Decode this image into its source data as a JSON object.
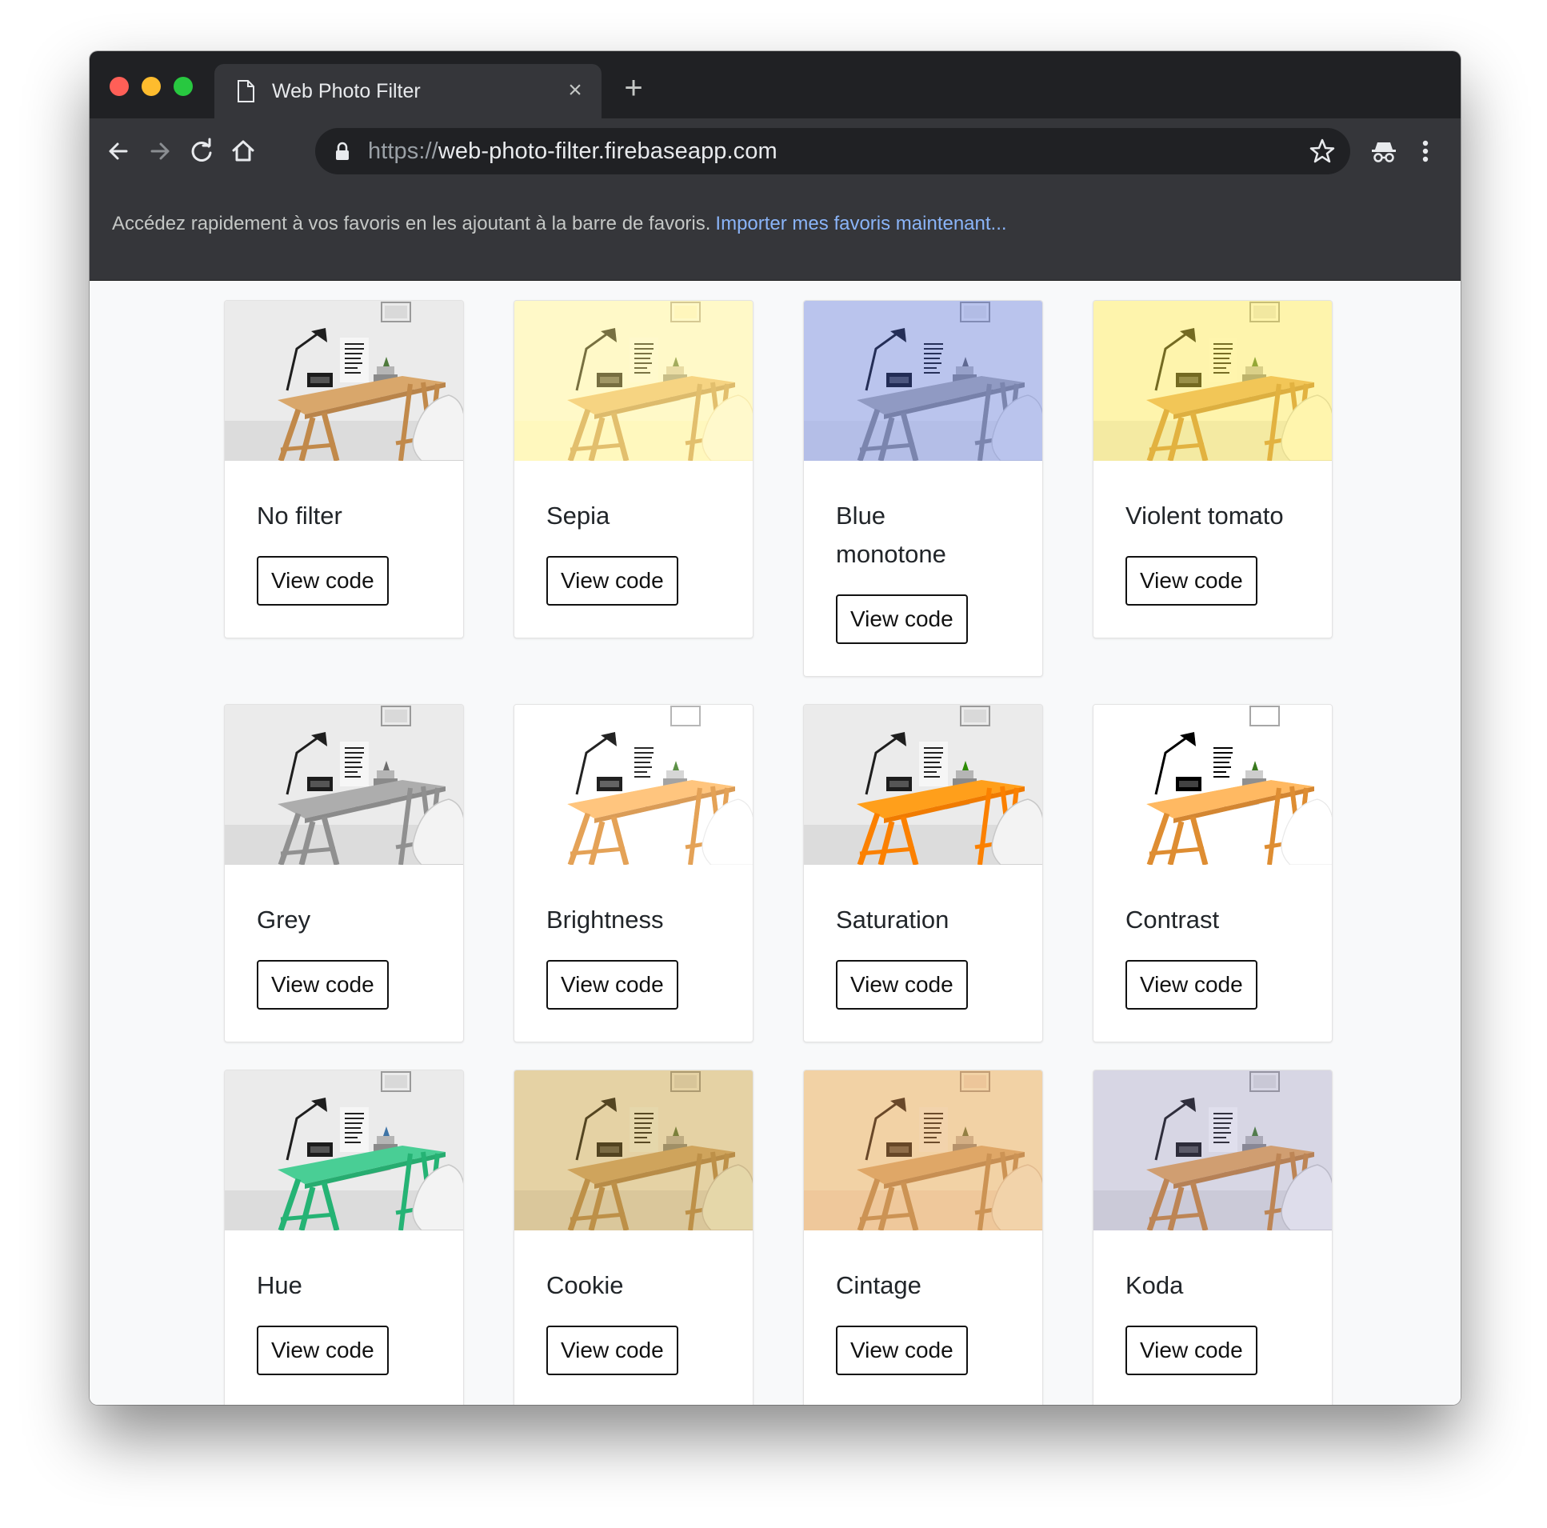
{
  "browser": {
    "tab_title": "Web Photo Filter",
    "tab_close": "×",
    "new_tab": "+",
    "url_scheme": "https://",
    "url_host": "web-photo-filter.firebaseapp.com"
  },
  "bookmark_bar": {
    "hint": "Accédez rapidement à vos favoris en les ajoutant à la barre de favoris.",
    "import_link": "Importer mes favoris maintenant..."
  },
  "filters": [
    {
      "title": "No filter",
      "button": "View code",
      "filter": "none"
    },
    {
      "title": "Sepia",
      "button": "View code",
      "filter": "sepia"
    },
    {
      "title": "Blue monotone",
      "button": "View code",
      "filter": "blue"
    },
    {
      "title": "Violent tomato",
      "button": "View code",
      "filter": "tomato"
    },
    {
      "title": "Grey",
      "button": "View code",
      "filter": "grey"
    },
    {
      "title": "Brightness",
      "button": "View code",
      "filter": "brightness"
    },
    {
      "title": "Saturation",
      "button": "View code",
      "filter": "saturation"
    },
    {
      "title": "Contrast",
      "button": "View code",
      "filter": "contrast"
    },
    {
      "title": "Hue",
      "button": "View code",
      "filter": "hue"
    },
    {
      "title": "Cookie",
      "button": "View code",
      "filter": "cookie"
    },
    {
      "title": "Cintage",
      "button": "View code",
      "filter": "cintage"
    },
    {
      "title": "Koda",
      "button": "View code",
      "filter": "koda"
    }
  ]
}
